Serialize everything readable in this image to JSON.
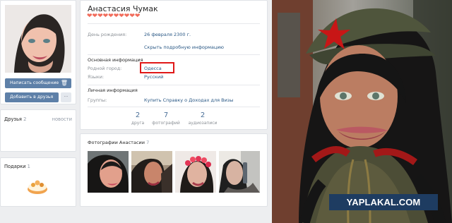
{
  "profile": {
    "name": "Анастасия Чумак",
    "hearts": "❤❤❤❤❤❤❤❤❤❤",
    "fields": [
      {
        "label": "День рождения:",
        "value": "26 февраля 2300 г."
      },
      {
        "label": "",
        "value": "Скрыть подробную информацию"
      },
      {
        "label": "Родной город:",
        "value": "Одесса"
      },
      {
        "label": "Языки:",
        "value": "Русский"
      },
      {
        "label": "Группы:",
        "value": "Купить Справку о Доходах для Визы"
      }
    ],
    "sections": {
      "main": "Основная информация",
      "personal": "Личная информация"
    },
    "stats": [
      {
        "value": "2",
        "label": "друга"
      },
      {
        "value": "7",
        "label": "фотографий"
      },
      {
        "value": "2",
        "label": "аудиозаписи"
      }
    ]
  },
  "sidebar": {
    "message_button": "Написать сообщение",
    "friend_button": "Добавить в друзья",
    "more_button": "···",
    "friends_title": "Друзья",
    "friends_count": "2",
    "friends_news": "новости",
    "gifts_title": "Подарки",
    "gifts_count": "1"
  },
  "photos": {
    "title": "Фотографии Анастасии",
    "count": "7"
  },
  "watermark": "YAPLAKAL.COM",
  "colors": {
    "page_background": "#edeef0",
    "button_blue": "#5e80a8",
    "link_blue": "#2a5885",
    "highlight_red": "#e01818",
    "watermark_blue": "#1e3c61"
  },
  "icons": {
    "trash": "trash-icon",
    "more": "more-icon"
  }
}
